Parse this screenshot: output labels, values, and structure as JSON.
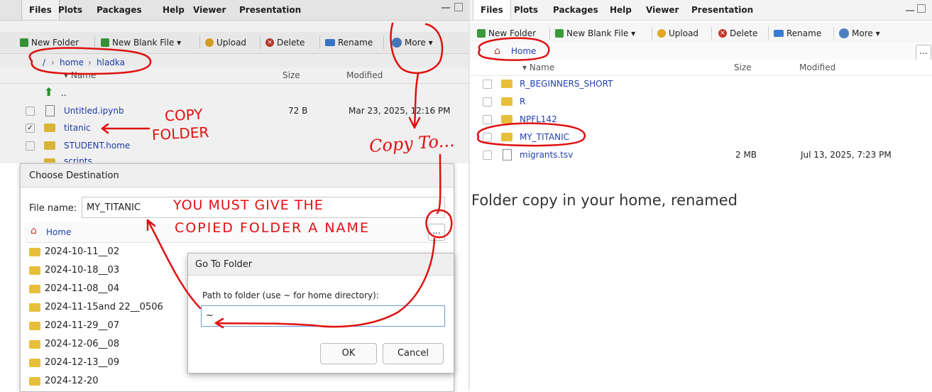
{
  "left": {
    "tabs": [
      "Files",
      "Plots",
      "Packages",
      "Help",
      "Viewer",
      "Presentation"
    ],
    "toolbar": {
      "new_folder": "New Folder",
      "new_blank_file": "New Blank File",
      "upload": "Upload",
      "delete": "Delete",
      "rename": "Rename",
      "more": "More"
    },
    "path": [
      "/",
      "home",
      "hladka"
    ],
    "columns": {
      "name": "Name",
      "size": "Size",
      "modified": "Modified"
    },
    "up": "..",
    "files": [
      {
        "name": "Untitled.ipynb",
        "size": "72 B",
        "modified": "Mar 23, 2025, 12:16 PM"
      },
      {
        "name": "titanic",
        "size": "",
        "modified": ""
      },
      {
        "name": "STUDENT.home",
        "size": "",
        "modified": ""
      },
      {
        "name": "scripts",
        "size": "",
        "modified": ""
      }
    ],
    "dialog": {
      "title": "Choose Destination",
      "file_name_label": "File name:",
      "file_name_value": "MY_TITANIC",
      "home_label": "Home",
      "more_label": "...",
      "folders": [
        "2024-10-11__02",
        "2024-10-18__03",
        "2024-11-08__04",
        "2024-11-15and 22__0506",
        "2024-11-29__07",
        "2024-12-06__08",
        "2024-12-13__09",
        "2024-12-20"
      ]
    },
    "goto": {
      "title": "Go To Folder",
      "label": "Path to folder (use ~ for home directory):",
      "value": "~",
      "ok": "OK",
      "cancel": "Cancel"
    },
    "annotations": {
      "copy": "COPY",
      "folder": "FOLDER",
      "copy_to": "Copy To...",
      "must1": "YOU MUST GIVE THE",
      "must2": "COPIED FOLDER A NAME"
    }
  },
  "right": {
    "tabs": [
      "Files",
      "Plots",
      "Packages",
      "Help",
      "Viewer",
      "Presentation"
    ],
    "toolbar": {
      "new_folder": "New Folder",
      "new_blank_file": "New Blank File",
      "upload": "Upload",
      "delete": "Delete",
      "rename": "Rename",
      "more": "More"
    },
    "path_home": "Home",
    "more_label": "...",
    "columns": {
      "name": "Name",
      "size": "Size",
      "modified": "Modified"
    },
    "files": [
      {
        "name": "R_BEGINNERS_SHORT",
        "size": "",
        "modified": ""
      },
      {
        "name": "R",
        "size": "",
        "modified": ""
      },
      {
        "name": "NPFL142",
        "size": "",
        "modified": ""
      },
      {
        "name": "MY_TITANIC",
        "size": "",
        "modified": ""
      },
      {
        "name": "migrants.tsv",
        "size": "2 MB",
        "modified": "Jul 13, 2025, 7:23 PM"
      }
    ],
    "caption": "Folder copy in your home, renamed"
  }
}
